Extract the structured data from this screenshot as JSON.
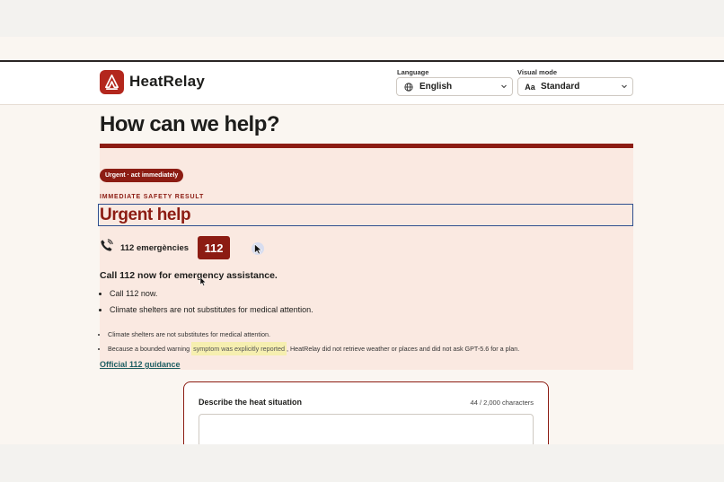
{
  "header": {
    "brand": "HeatRelay",
    "language_label": "Language",
    "language_value": "English",
    "visual_label": "Visual mode",
    "visual_value": "Standard"
  },
  "main": {
    "heading": "How can we help?",
    "badge": "Urgent · act immediately",
    "eyebrow": "IMMEDIATE SAFETY RESULT",
    "urgent_title": "Urgent help",
    "phone_label": "112 emergències",
    "phone_number": "112",
    "instruction": "Call 112 now for emergency assistance.",
    "actions": [
      "Call 112 now.",
      "Climate shelters are not substitutes for medical attention."
    ],
    "notes": {
      "note1": "Climate shelters are not substitutes for medical attention.",
      "note2_pre": "Because a bounded warning ",
      "note2_highlight": "symptom was explicitly reported",
      "note2_post": ", HeatRelay did not retrieve weather or places and did not ask GPT-5.6 for a plan."
    },
    "official_link": "Official 112 guidance"
  },
  "form": {
    "title": "Describe the heat situation",
    "char_count": "44 / 2,000 characters"
  },
  "colors": {
    "brand": "#b3271d",
    "urgent": "#8c1c13",
    "focus": "#2e4f8f",
    "link": "#1f5f63"
  },
  "icons": {
    "logo": "heatrelay-logo-icon",
    "language": "globe-icon",
    "visual": "text-size-icon",
    "phone": "phone-icon",
    "chevron": "chevron-down-icon"
  }
}
